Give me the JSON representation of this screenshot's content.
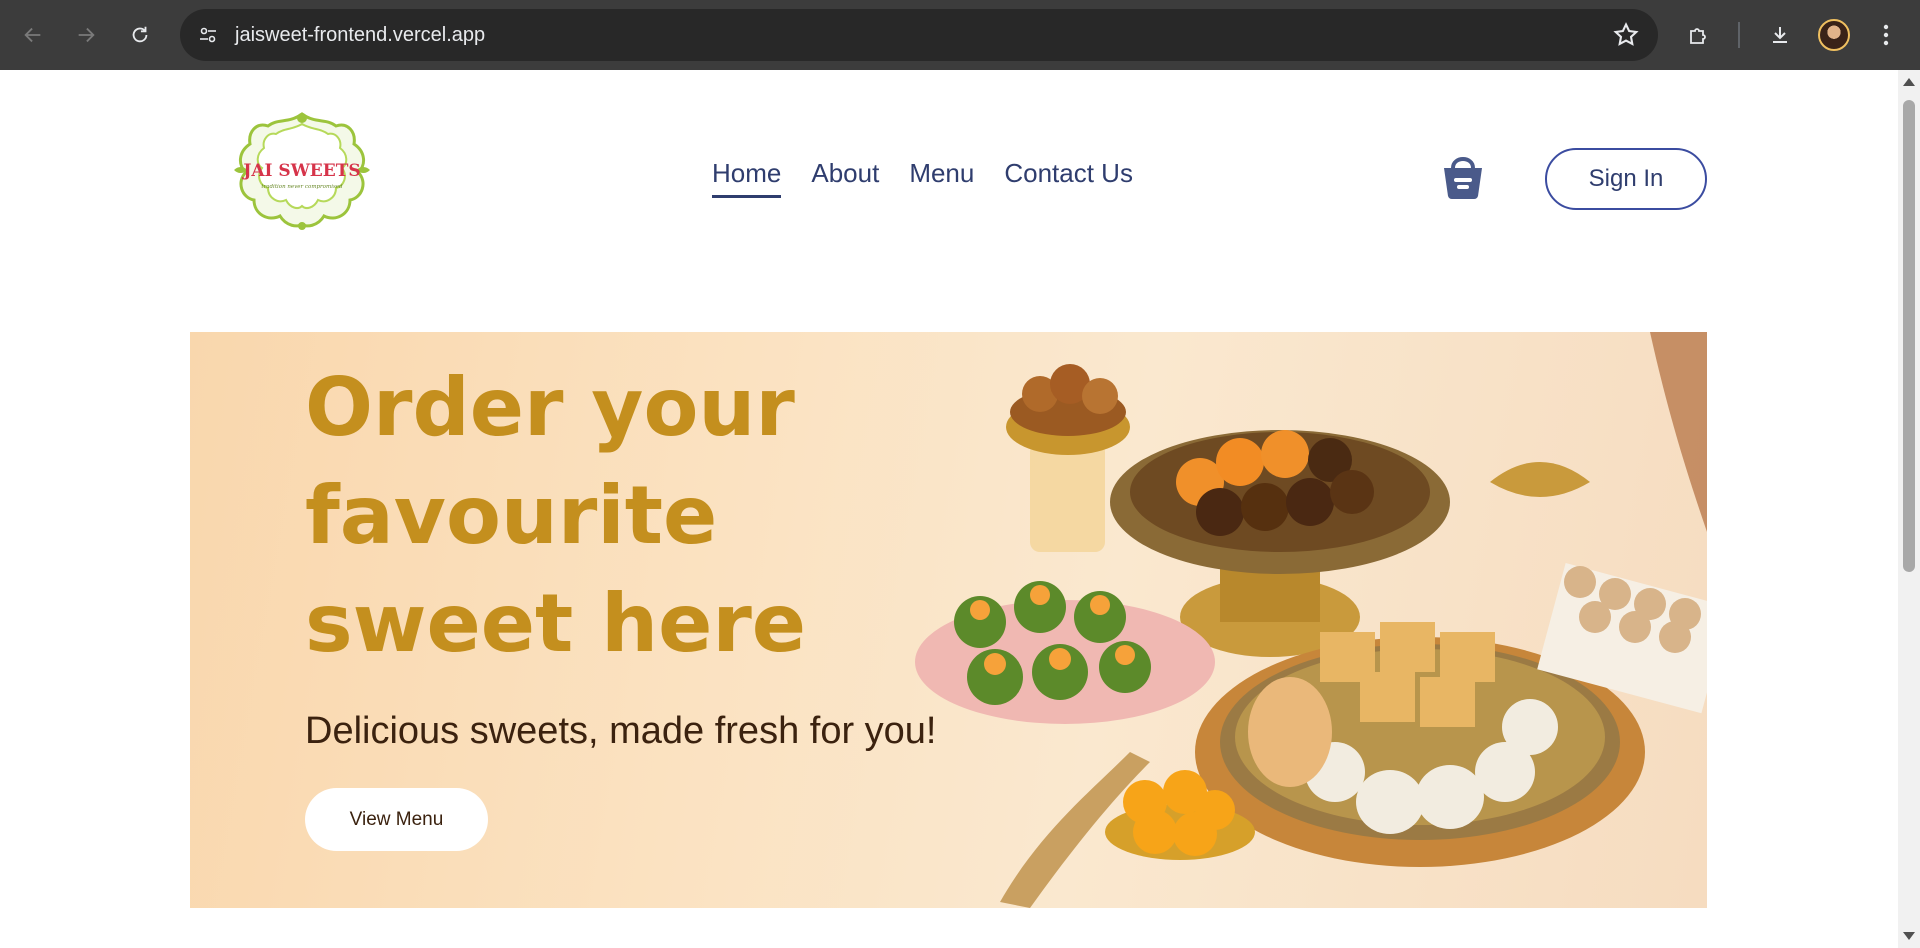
{
  "browser": {
    "url": "jaisweet-frontend.vercel.app"
  },
  "logo": {
    "text": "JAI SWEETS",
    "tagline": "tradition never compromised"
  },
  "nav": {
    "links": [
      {
        "label": "Home",
        "active": true
      },
      {
        "label": "About",
        "active": false
      },
      {
        "label": "Menu",
        "active": false
      },
      {
        "label": "Contact Us",
        "active": false
      }
    ],
    "sign_in": "Sign In"
  },
  "hero": {
    "title": "Order your favourite sweet here",
    "subtitle": "Delicious sweets, made fresh for you!",
    "button": "View Menu"
  },
  "colors": {
    "accent_gold": "#c48f1e",
    "nav_navy": "#2f3d6e",
    "hero_bg": "#fbe2c1"
  }
}
